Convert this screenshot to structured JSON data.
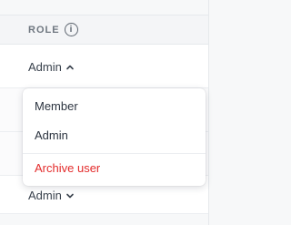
{
  "header": {
    "role_title": "ROLE",
    "info_icon": "info-icon"
  },
  "rows": [
    {
      "role": "Admin",
      "chevron": "chevron-up-icon"
    },
    {
      "role": "Admin",
      "chevron": "chevron-down-icon"
    }
  ],
  "menu": {
    "items": [
      "Member",
      "Admin"
    ],
    "danger_item": "Archive user"
  },
  "colors": {
    "danger": "#e32b2b",
    "text": "#2c3440",
    "header_bg": "#f4f5f7"
  }
}
